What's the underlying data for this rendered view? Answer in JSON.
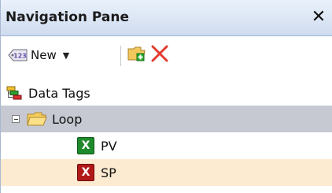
{
  "panel": {
    "title": "Navigation Pane",
    "close_glyph": "✕",
    "close_icon": "close-icon"
  },
  "toolbar": {
    "new_label": "New",
    "new_icon": "tag-icon",
    "new_dropdown_icon": "chevron-down-icon",
    "add_folder_icon": "add-folder-icon",
    "delete_icon": "delete-x-icon"
  },
  "tree": {
    "root": {
      "label": "Data Tags",
      "icon": "data-tags-icon"
    },
    "folder": {
      "label": "Loop",
      "icon": "folder-icon",
      "expanded": true,
      "selected": true
    },
    "items": [
      {
        "label": "PV",
        "icon": "excel-green-icon",
        "status": "ok"
      },
      {
        "label": "SP",
        "icon": "excel-red-icon",
        "status": "error",
        "highlighted": true
      }
    ]
  },
  "colors": {
    "title_gradient_top": "#eaf1fb",
    "title_gradient_bottom": "#cfdcef",
    "selected_row": "#c6c9d2",
    "highlight_row": "#fcebd0",
    "excel_green": "#1f8a2c",
    "excel_red": "#b11919"
  }
}
